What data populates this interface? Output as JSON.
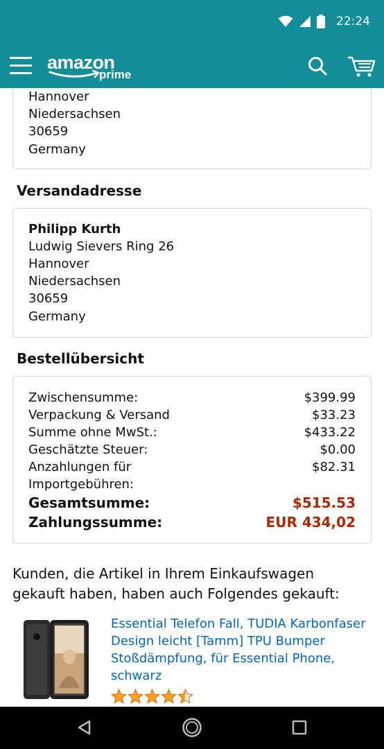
{
  "status_bar": {
    "time": "22:24"
  },
  "app_bar": {
    "logo_text": "amazon",
    "logo_sub": "prime",
    "brand_color": "#138e99",
    "icons": [
      "menu-icon",
      "search-icon",
      "cart-icon"
    ]
  },
  "billing_address_partial": {
    "lines": [
      "Hannover",
      "Niedersachsen",
      "30659",
      "Germany"
    ]
  },
  "shipping": {
    "title": "Versandadresse",
    "name": "Philipp Kurth",
    "lines": [
      "Ludwig Sievers Ring 26",
      "Hannover",
      "Niedersachsen",
      "30659",
      "Germany"
    ]
  },
  "summary": {
    "title": "Bestellübersicht",
    "rows": [
      {
        "label": "Zwischensumme:",
        "value": "$399.99"
      },
      {
        "label": "Verpackung & Versand",
        "value": "$33.23"
      },
      {
        "label": "Summe ohne MwSt.:",
        "value": "$433.22"
      },
      {
        "label": "Geschätzte Steuer:",
        "value": "$0.00"
      },
      {
        "label": "Anzahlungen für",
        "label2": "Importgebühren:",
        "value": "$82.31"
      }
    ],
    "total_label": "Gesamtsumme:",
    "total_value": "$515.53",
    "payment_label": "Zahlungssumme:",
    "payment_value": "EUR 434,02",
    "total_color": "#b12704"
  },
  "recommendations": {
    "title_line1": "Kunden, die Artikel in Ihrem Einkaufswagen",
    "title_line2": "gekauft haben, haben auch Folgendes gekauft:",
    "item": {
      "title_lines": [
        "Essential Telefon Fall, TUDIA Karbonfaser",
        "Design leicht [Tamm] TPU Bumper",
        "Stoßdämpfung, für Essential Phone,",
        "schwarz"
      ],
      "rating": 4.5,
      "rating_max": 5
    }
  }
}
